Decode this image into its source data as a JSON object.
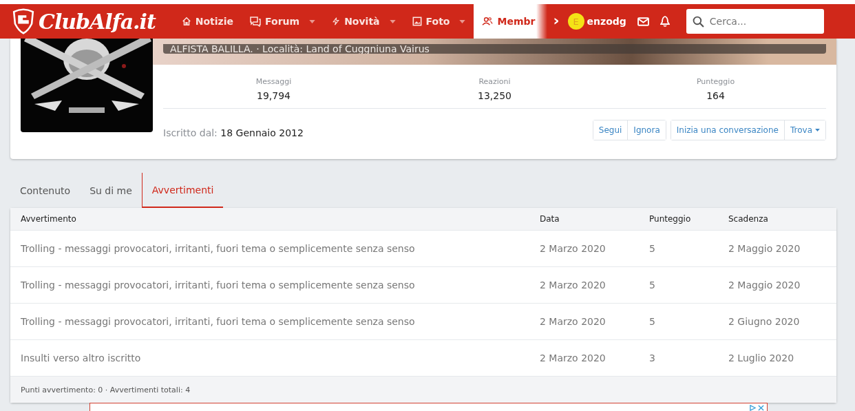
{
  "header": {
    "logo": "ClubAlfa.it",
    "nav": [
      {
        "label": "Notizie",
        "dropdown": false,
        "selected": false
      },
      {
        "label": "Forum",
        "dropdown": true,
        "selected": false
      },
      {
        "label": "Novità",
        "dropdown": true,
        "selected": false
      },
      {
        "label": "Foto",
        "dropdown": true,
        "selected": false
      },
      {
        "label": "Membr",
        "dropdown": false,
        "selected": true
      }
    ],
    "scroll_arrow": "›",
    "user": {
      "initial": "E",
      "name": "enzodg"
    },
    "search": {
      "placeholder": "Cerca..."
    }
  },
  "profile": {
    "banner_text": "ALFISTA BALILLA. · Località: Land of Cuggniuna Vairus",
    "stats": [
      {
        "label": "Messaggi",
        "value": "19,794"
      },
      {
        "label": "Reazioni",
        "value": "13,250"
      },
      {
        "label": "Punteggio",
        "value": "164"
      }
    ],
    "joined_label": "Iscritto dal:",
    "joined_value": "18 Gennaio 2012",
    "button_groups": [
      [
        {
          "label": "Segui",
          "dropdown": false
        },
        {
          "label": "Ignora",
          "dropdown": false
        }
      ],
      [
        {
          "label": "Inizia una conversazione",
          "dropdown": false
        },
        {
          "label": "Trova",
          "dropdown": true
        }
      ]
    ]
  },
  "tabs": [
    {
      "label": "Contenuto",
      "selected": false
    },
    {
      "label": "Su di me",
      "selected": false
    },
    {
      "label": "Avvertimenti",
      "selected": true
    }
  ],
  "table": {
    "columns": [
      "Avvertimento",
      "Data",
      "Punteggio",
      "Scadenza"
    ],
    "rows": [
      [
        "Trolling - messaggi provocatori, irritanti, fuori tema o semplicemente senza senso",
        "2 Marzo 2020",
        "5",
        "2 Maggio 2020"
      ],
      [
        "Trolling - messaggi provocatori, irritanti, fuori tema o semplicemente senza senso",
        "2 Marzo 2020",
        "5",
        "2 Maggio 2020"
      ],
      [
        "Trolling - messaggi provocatori, irritanti, fuori tema o semplicemente senza senso",
        "2 Marzo 2020",
        "5",
        "2 Giugno 2020"
      ],
      [
        "Insulti verso altro iscritto",
        "2 Marzo 2020",
        "3",
        "2 Luglio 2020"
      ]
    ],
    "footer": "Punti avvertimento: 0 · Avvertimenti totali: 4"
  }
}
